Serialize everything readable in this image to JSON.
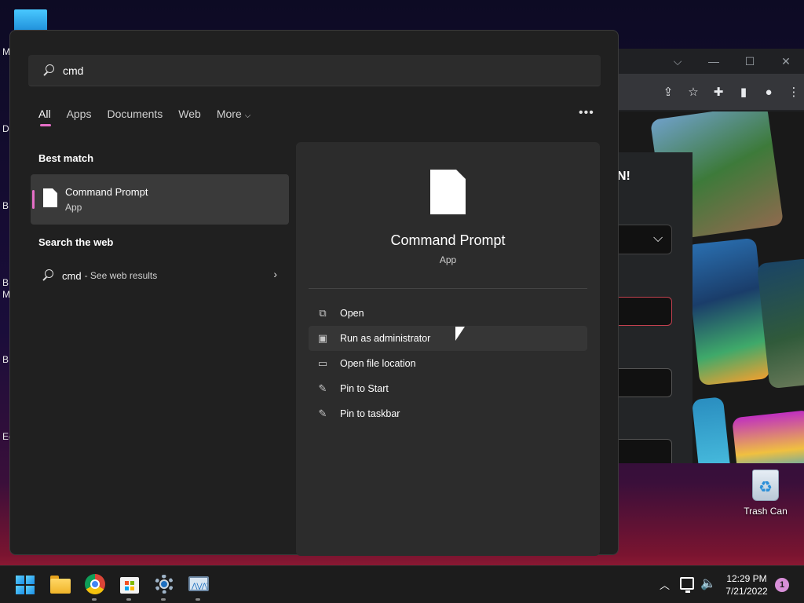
{
  "desktop": {
    "left_letters": [
      "M",
      "Da",
      "B",
      "B",
      "M",
      "B",
      "Ec"
    ],
    "trash_label": "Trash Can"
  },
  "browser": {
    "controls": {
      "dropdown": "⌵",
      "minimize": "—",
      "maximize": "☐",
      "close": "✕"
    },
    "page_text": "N!"
  },
  "search": {
    "query": "cmd",
    "tabs": [
      "All",
      "Apps",
      "Documents",
      "Web",
      "More"
    ],
    "more_chevron": "⌵",
    "overflow": "•••"
  },
  "results": {
    "best_match_title": "Best match",
    "best": {
      "name": "Command Prompt",
      "type": "App"
    },
    "web_title": "Search the web",
    "web_term": "cmd",
    "web_suffix": "- See web results"
  },
  "detail": {
    "name": "Command Prompt",
    "type": "App",
    "actions": [
      {
        "label": "Open",
        "icon": "open-external-icon"
      },
      {
        "label": "Run as administrator",
        "icon": "shield-admin-icon"
      },
      {
        "label": "Open file location",
        "icon": "folder-icon"
      },
      {
        "label": "Pin to Start",
        "icon": "pin-icon"
      },
      {
        "label": "Pin to taskbar",
        "icon": "pin-icon"
      }
    ]
  },
  "taskbar": {
    "apps": [
      "start-icon",
      "file-explorer-icon",
      "chrome-icon",
      "microsoft-store-icon",
      "settings-icon",
      "resource-monitor-icon"
    ],
    "time": "12:29 PM",
    "date": "7/21/2022",
    "notification_count": "1"
  }
}
